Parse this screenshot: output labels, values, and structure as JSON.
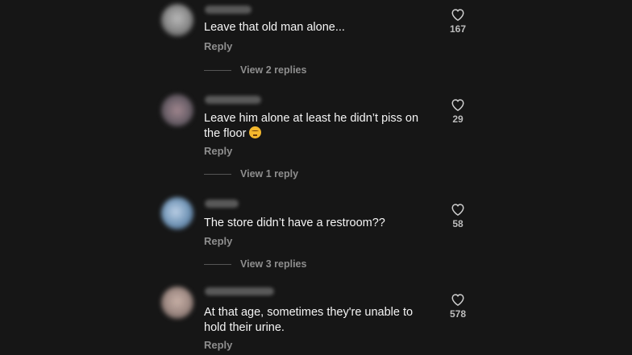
{
  "comments": [
    {
      "text": "Leave that old man alone...",
      "reply_label": "Reply",
      "replies_label": "View 2 replies",
      "likes": "167",
      "avatar_color": "#8a8a8a"
    },
    {
      "text": "Leave him alone at least he didn’t piss on the floor",
      "emoji": "unamused-face-emoji",
      "reply_label": "Reply",
      "replies_label": "View 1 reply",
      "likes": "29",
      "avatar_color": "#7a6e78"
    },
    {
      "text": "The store didn’t have a restroom??",
      "reply_label": "Reply",
      "replies_label": "View 3 replies",
      "likes": "58",
      "avatar_color": "#6f93b5"
    },
    {
      "text": "At that age, sometimes they're unable to hold their urine.",
      "reply_label": "Reply",
      "likes": "578",
      "avatar_color": "#9a8680"
    }
  ],
  "icons": {
    "like": "heart-outline-icon"
  },
  "colors": {
    "background": "#161616",
    "secondary_text": "#8e8e8e"
  }
}
